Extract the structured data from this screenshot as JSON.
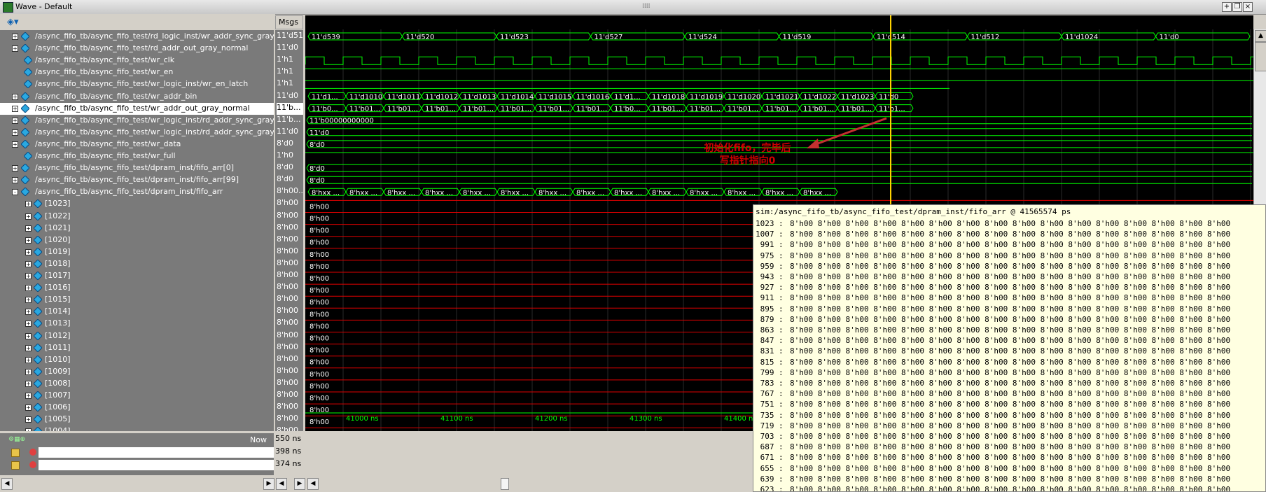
{
  "window": {
    "title": "Wave - Default",
    "button_min": "-",
    "button_max": "+",
    "button_restore": "❐",
    "button_close": "×"
  },
  "headers": {
    "msgs": "Msgs"
  },
  "signals": [
    {
      "name": "/async_fifo_tb/async_fifo_test/rd_logic_inst/wr_addr_sync_gray",
      "value": "11'd514",
      "kind": "bus",
      "expander": "+"
    },
    {
      "name": "/async_fifo_tb/async_fifo_test/rd_addr_out_gray_normal",
      "value": "11'd0",
      "kind": "bus",
      "expander": "+"
    },
    {
      "name": "/async_fifo_tb/async_fifo_test/wr_clk",
      "value": "1'h1",
      "kind": "bit",
      "expander": ""
    },
    {
      "name": "/async_fifo_tb/async_fifo_test/wr_en",
      "value": "1'h1",
      "kind": "bit",
      "expander": ""
    },
    {
      "name": "/async_fifo_tb/async_fifo_test/wr_logic_inst/wr_en_latch",
      "value": "1'h1",
      "kind": "bit",
      "expander": ""
    },
    {
      "name": "/async_fifo_tb/async_fifo_test/wr_addr_bin",
      "value": "11'd0",
      "kind": "bus",
      "expander": "+"
    },
    {
      "name": "/async_fifo_tb/async_fifo_test/wr_addr_out_gray_normal",
      "value": "11'b...",
      "kind": "bus",
      "expander": "+",
      "selected": true
    },
    {
      "name": "/async_fifo_tb/async_fifo_test/wr_logic_inst/rd_addr_sync_gray",
      "value": "11'b...",
      "kind": "bus",
      "expander": "+"
    },
    {
      "name": "/async_fifo_tb/async_fifo_test/wr_logic_inst/rd_addr_sync_gray_bin",
      "value": "11'd0",
      "kind": "bus",
      "expander": "+"
    },
    {
      "name": "/async_fifo_tb/async_fifo_test/wr_data",
      "value": "8'd0",
      "kind": "bus",
      "expander": "+"
    },
    {
      "name": "/async_fifo_tb/async_fifo_test/wr_full",
      "value": "1'h0",
      "kind": "bit",
      "expander": ""
    },
    {
      "name": "/async_fifo_tb/async_fifo_test/dpram_inst/fifo_arr[0]",
      "value": "8'd0",
      "kind": "bus",
      "expander": "+"
    },
    {
      "name": "/async_fifo_tb/async_fifo_test/dpram_inst/fifo_arr[99]",
      "value": "8'd0",
      "kind": "bus",
      "expander": "+"
    },
    {
      "name": "/async_fifo_tb/async_fifo_test/dpram_inst/fifo_arr",
      "value": "8'h00...",
      "kind": "bus",
      "expander": "-"
    },
    {
      "name": "[1023]",
      "value": "8'h00",
      "kind": "sub",
      "expander": "+"
    },
    {
      "name": "[1022]",
      "value": "8'h00",
      "kind": "sub",
      "expander": "+"
    },
    {
      "name": "[1021]",
      "value": "8'h00",
      "kind": "sub",
      "expander": "+"
    },
    {
      "name": "[1020]",
      "value": "8'h00",
      "kind": "sub",
      "expander": "+"
    },
    {
      "name": "[1019]",
      "value": "8'h00",
      "kind": "sub",
      "expander": "+"
    },
    {
      "name": "[1018]",
      "value": "8'h00",
      "kind": "sub",
      "expander": "+"
    },
    {
      "name": "[1017]",
      "value": "8'h00",
      "kind": "sub",
      "expander": "+"
    },
    {
      "name": "[1016]",
      "value": "8'h00",
      "kind": "sub",
      "expander": "+"
    },
    {
      "name": "[1015]",
      "value": "8'h00",
      "kind": "sub",
      "expander": "+"
    },
    {
      "name": "[1014]",
      "value": "8'h00",
      "kind": "sub",
      "expander": "+"
    },
    {
      "name": "[1013]",
      "value": "8'h00",
      "kind": "sub",
      "expander": "+"
    },
    {
      "name": "[1012]",
      "value": "8'h00",
      "kind": "sub",
      "expander": "+"
    },
    {
      "name": "[1011]",
      "value": "8'h00",
      "kind": "sub",
      "expander": "+"
    },
    {
      "name": "[1010]",
      "value": "8'h00",
      "kind": "sub",
      "expander": "+"
    },
    {
      "name": "[1009]",
      "value": "8'h00",
      "kind": "sub",
      "expander": "+"
    },
    {
      "name": "[1008]",
      "value": "8'h00",
      "kind": "sub",
      "expander": "+"
    },
    {
      "name": "[1007]",
      "value": "8'h00",
      "kind": "sub",
      "expander": "+"
    },
    {
      "name": "[1006]",
      "value": "8'h00",
      "kind": "sub",
      "expander": "+"
    },
    {
      "name": "[1005]",
      "value": "8'h00",
      "kind": "sub",
      "expander": "+"
    },
    {
      "name": "[1004]",
      "value": "8'h00",
      "kind": "sub",
      "expander": "+"
    }
  ],
  "wave_labels": {
    "row0": [
      "11'd539",
      "11'd520",
      "11'd523",
      "11'd527",
      "11'd524",
      "11'd519",
      "11'd514",
      "11'd512",
      "11'd1024",
      "11'd0"
    ],
    "row5": [
      "11'd1...",
      "11'd1010",
      "11'd1011",
      "11'd1012",
      "11'd1013",
      "11'd1014",
      "11'd1015",
      "11'd1016",
      "11'd1...",
      "11'd1018",
      "11'd1019",
      "11'd1020",
      "11'd1021",
      "11'd1022",
      "11'd1023",
      "11'd0"
    ],
    "row6": [
      "11'b0...",
      "11'b01...",
      "11'b01...",
      "11'b01...",
      "11'b01...",
      "11'b01...",
      "11'b01...",
      "11'b01...",
      "11'b0...",
      "11'b01...",
      "11'b01...",
      "11'b01...",
      "11'b01...",
      "11'b01...",
      "11'b01...",
      "11'b1...",
      "11'b10000000000",
      "11'b00000000000"
    ],
    "row7": "11'b00000000000",
    "row8": "11'd0",
    "row9": "8'd0",
    "row11": "8'd0",
    "row12": "8'd0",
    "row13": [
      "8'hxx ...",
      "8'hxx ...",
      "8'hxx ...",
      "8'hxx ...",
      "8'hxx ...",
      "8'hxx ...",
      "8'hxx ...",
      "8'hxx ...",
      "8'hxx ...",
      "8'hxx ...",
      "8'hxx ...",
      "8'hxx ...",
      "8'hxx ...",
      "8'hxx ...",
      "8'h00",
      "8'h00",
      "8'h00",
      "8'h00",
      "8'h00",
      "8'h00",
      "8'h00",
      "8'h00",
      "8'h00",
      "8'h00",
      "8'h00",
      "8'h00",
      "8'h00",
      "8'h00",
      "8'h00",
      "8'h00",
      "8'h00",
      "8'h0..."
    ],
    "sub_value": "8'h00"
  },
  "cursor_footer": [
    {
      "label": "Now",
      "value": "550 ns"
    },
    {
      "label": "Cursor 2",
      "value": "398 ns"
    },
    {
      "label": "Cursor 3",
      "value": "374 ns"
    }
  ],
  "time_axis": [
    "41000 ns",
    "41100 ns",
    "41200 ns",
    "41300 ns",
    "41400 ns"
  ],
  "annotation": {
    "line1": "初始化fifo，完毕后",
    "line2": "写指针指向0"
  },
  "popup": {
    "title": "sim:/async_fifo_tb/async_fifo_test/dpram_inst/fifo_arr @ 41565574 ps",
    "row_indices": [
      "1023",
      "1007",
      " 991",
      " 975",
      " 959",
      " 943",
      " 927",
      " 911",
      " 895",
      " 879",
      " 863",
      " 847",
      " 831",
      " 815",
      " 799",
      " 783",
      " 767",
      " 751",
      " 735",
      " 719",
      " 703",
      " 687",
      " 671",
      " 655",
      " 639",
      " 623"
    ],
    "row_values": "8'h00 8'h00 8'h00 8'h00 8'h00 8'h00 8'h00 8'h00 8'h00 8'h00 8'h00 8'h00 8'h00 8'h00 8'h00 8'h00"
  },
  "colors": {
    "wave_green": "#00ff00",
    "wave_red": "#e00000",
    "cursor_yellow": "#ffd200",
    "annotation_red": "#d10000"
  }
}
